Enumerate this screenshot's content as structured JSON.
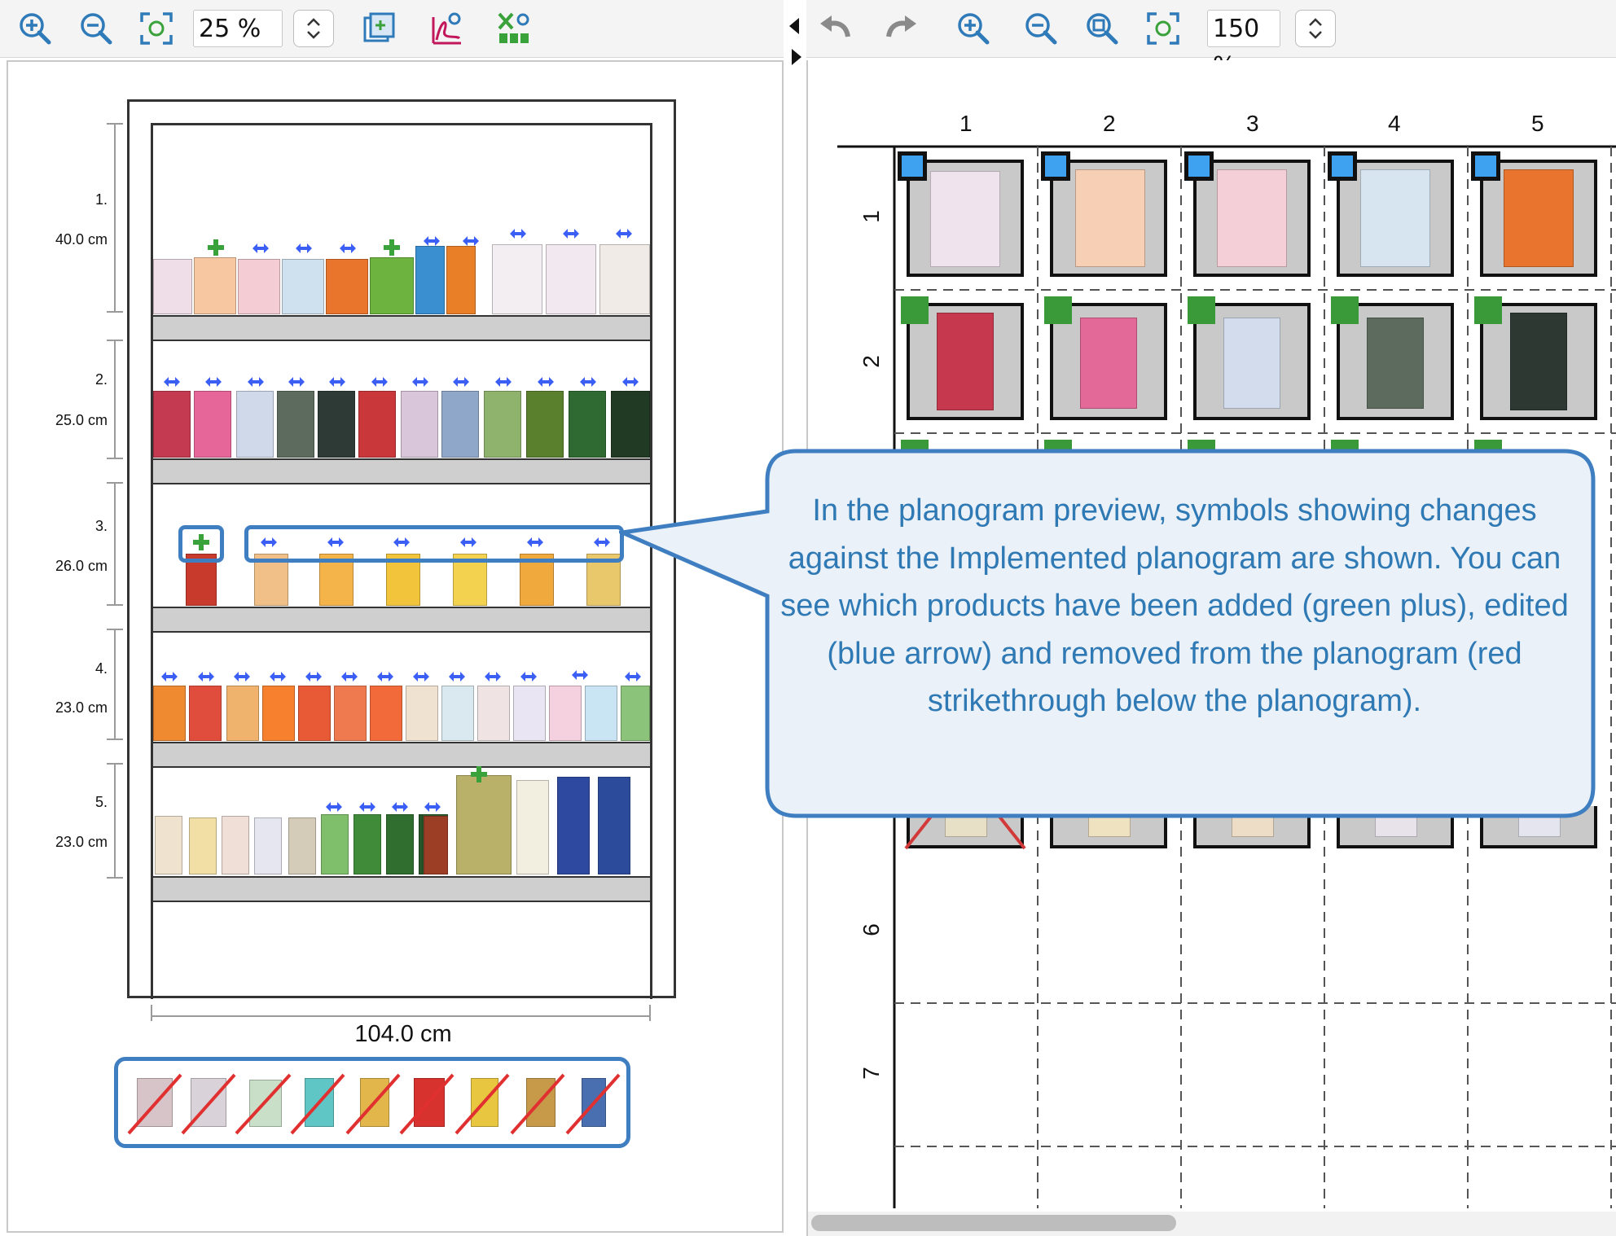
{
  "left_toolbar": {
    "zoom_in": "zoom-in-icon",
    "zoom_out": "zoom-out-icon",
    "fit": "fit-to-screen-icon",
    "zoom_value": "25 %",
    "export_image": "export-image-icon",
    "export_pdf": "export-pdf-icon",
    "export_excel": "export-excel-icon"
  },
  "right_toolbar": {
    "undo": "undo-icon",
    "redo": "redo-icon",
    "zoom_value": "150 %"
  },
  "fixture": {
    "width_label": "104.0 cm",
    "shelves": [
      {
        "number": "1.",
        "height": "40.0 cm"
      },
      {
        "number": "2.",
        "height": "25.0 cm"
      },
      {
        "number": "3.",
        "height": "26.0 cm"
      },
      {
        "number": "4.",
        "height": "23.0 cm"
      },
      {
        "number": "5.",
        "height": "23.0 cm"
      }
    ]
  },
  "grid": {
    "columns": [
      "1",
      "2",
      "3",
      "4",
      "5"
    ],
    "rows": [
      "1",
      "2",
      "6",
      "7"
    ]
  },
  "callout": {
    "text": "In the planogram preview, symbols showing changes against the Implemented planogram are shown. You can see which products have been added (green plus), edited (blue arrow) and removed from the planogram (red strikethrough below the planogram)."
  },
  "colors": {
    "accent_blue": "#3f7fc1",
    "added_green": "#3aa23a",
    "edited_blue": "#3b5ef5",
    "removed_red": "#e03030",
    "callout_bg": "#eaf1f8",
    "callout_text": "#2f79b4"
  }
}
